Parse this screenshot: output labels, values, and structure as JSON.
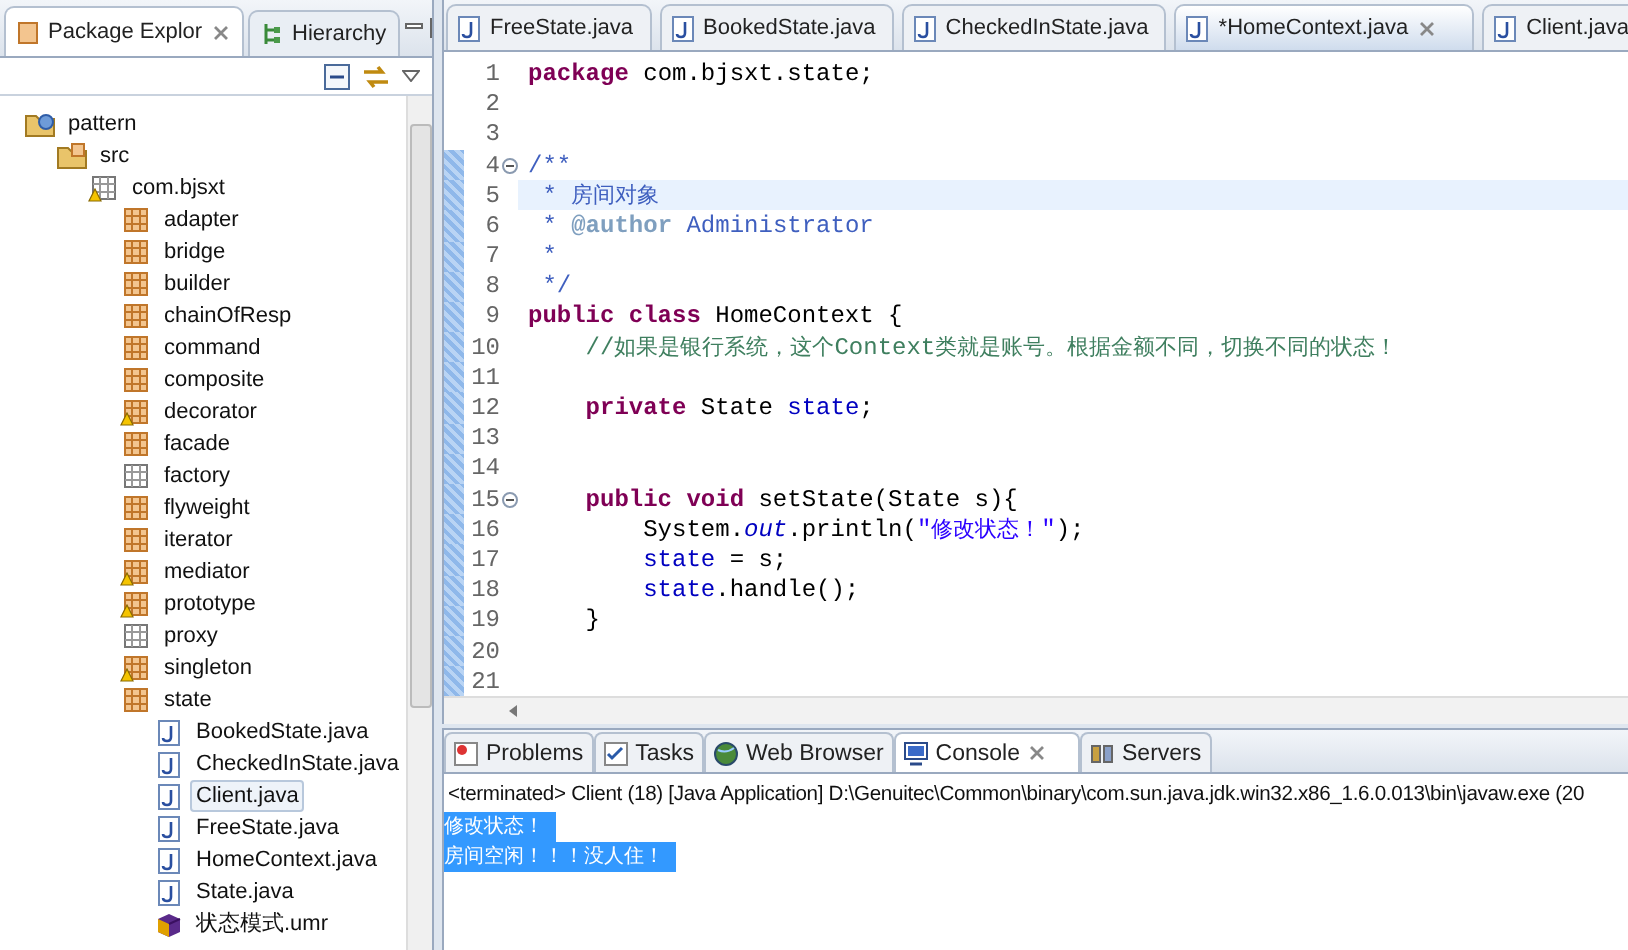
{
  "explorer": {
    "tabs": [
      {
        "label": "Package Explor",
        "selected": true
      },
      {
        "label": "Hierarchy",
        "selected": false
      }
    ],
    "tree": [
      {
        "label": "pattern",
        "kind": "project",
        "selected": false,
        "warning": false,
        "children": [
          {
            "label": "src",
            "kind": "source-folder",
            "selected": false,
            "warning": false,
            "children": [
              {
                "label": "com.bjsxt",
                "kind": "empty-package",
                "selected": false,
                "warning": true,
                "children": [
                  {
                    "label": "adapter",
                    "kind": "package",
                    "selected": false,
                    "warning": false
                  },
                  {
                    "label": "bridge",
                    "kind": "package",
                    "selected": false,
                    "warning": false
                  },
                  {
                    "label": "builder",
                    "kind": "package",
                    "selected": false,
                    "warning": false
                  },
                  {
                    "label": "chainOfResp",
                    "kind": "package",
                    "selected": false,
                    "warning": false
                  },
                  {
                    "label": "command",
                    "kind": "package",
                    "selected": false,
                    "warning": false
                  },
                  {
                    "label": "composite",
                    "kind": "package",
                    "selected": false,
                    "warning": false
                  },
                  {
                    "label": "decorator",
                    "kind": "package",
                    "selected": false,
                    "warning": true
                  },
                  {
                    "label": "facade",
                    "kind": "package",
                    "selected": false,
                    "warning": false
                  },
                  {
                    "label": "factory",
                    "kind": "empty-package",
                    "selected": false,
                    "warning": false
                  },
                  {
                    "label": "flyweight",
                    "kind": "package",
                    "selected": false,
                    "warning": false
                  },
                  {
                    "label": "iterator",
                    "kind": "package",
                    "selected": false,
                    "warning": false
                  },
                  {
                    "label": "mediator",
                    "kind": "package",
                    "selected": false,
                    "warning": true
                  },
                  {
                    "label": "prototype",
                    "kind": "package",
                    "selected": false,
                    "warning": true
                  },
                  {
                    "label": "proxy",
                    "kind": "empty-package",
                    "selected": false,
                    "warning": false
                  },
                  {
                    "label": "singleton",
                    "kind": "package",
                    "selected": false,
                    "warning": true
                  },
                  {
                    "label": "state",
                    "kind": "package",
                    "selected": false,
                    "warning": false,
                    "children": [
                      {
                        "label": "BookedState.java",
                        "kind": "java-file",
                        "selected": false,
                        "warning": false
                      },
                      {
                        "label": "CheckedInState.java",
                        "kind": "java-file",
                        "selected": false,
                        "warning": false
                      },
                      {
                        "label": "Client.java",
                        "kind": "java-file",
                        "selected": true,
                        "warning": false
                      },
                      {
                        "label": "FreeState.java",
                        "kind": "java-file",
                        "selected": false,
                        "warning": false
                      },
                      {
                        "label": "HomeContext.java",
                        "kind": "java-file",
                        "selected": false,
                        "warning": false
                      },
                      {
                        "label": "State.java",
                        "kind": "java-file",
                        "selected": false,
                        "warning": false
                      },
                      {
                        "label": "状态模式.umr",
                        "kind": "model-file",
                        "selected": false,
                        "warning": false
                      }
                    ]
                  }
                ]
              }
            ]
          }
        ]
      }
    ]
  },
  "editor": {
    "tabs": [
      {
        "label": "FreeState.java",
        "selected": false
      },
      {
        "label": "BookedState.java",
        "selected": false
      },
      {
        "label": "CheckedInState.java",
        "selected": false
      },
      {
        "label": "*HomeContext.java",
        "selected": true
      },
      {
        "label": "Client.java",
        "selected": false
      }
    ],
    "lines": [
      {
        "number": "1",
        "current": false,
        "changed": false,
        "fold": false,
        "tokens": [
          {
            "kind": "keyword",
            "text": "package"
          },
          {
            "kind": "plain",
            "text": " com.bjsxt.state;"
          }
        ]
      },
      {
        "number": "2",
        "current": false,
        "changed": false,
        "fold": false
      },
      {
        "number": "3",
        "current": false,
        "changed": false,
        "fold": false
      },
      {
        "number": "4",
        "current": false,
        "changed": true,
        "fold": true,
        "tokens": [
          {
            "kind": "javadoc",
            "text": "/**"
          }
        ]
      },
      {
        "number": "5",
        "current": true,
        "changed": true,
        "fold": false,
        "tokens": [
          {
            "kind": "javadoc",
            "text": " * 房间对象"
          }
        ]
      },
      {
        "number": "6",
        "current": false,
        "changed": true,
        "fold": false,
        "tokens": [
          {
            "kind": "javadoc",
            "text": " * "
          },
          {
            "kind": "javadoc-tag",
            "text": "@author"
          },
          {
            "kind": "javadoc",
            "text": " Administrator"
          }
        ]
      },
      {
        "number": "7",
        "current": false,
        "changed": true,
        "fold": false,
        "tokens": [
          {
            "kind": "javadoc",
            "text": " *"
          }
        ]
      },
      {
        "number": "8",
        "current": false,
        "changed": true,
        "fold": false,
        "tokens": [
          {
            "kind": "javadoc",
            "text": " */"
          }
        ]
      },
      {
        "number": "9",
        "current": false,
        "changed": true,
        "fold": false,
        "tokens": [
          {
            "kind": "keyword",
            "text": "public class"
          },
          {
            "kind": "plain",
            "text": " HomeContext {"
          }
        ]
      },
      {
        "number": "10",
        "current": false,
        "changed": true,
        "fold": false,
        "tokens": [
          {
            "kind": "comment",
            "text": "    //如果是银行系统，这个Context类就是账号。根据金额不同，切换不同的状态！"
          }
        ]
      },
      {
        "number": "11",
        "current": false,
        "changed": true,
        "fold": false
      },
      {
        "number": "12",
        "current": false,
        "changed": true,
        "fold": false,
        "tokens": [
          {
            "kind": "keyword",
            "text": "    private"
          },
          {
            "kind": "plain",
            "text": " State "
          },
          {
            "kind": "field",
            "text": "state"
          },
          {
            "kind": "plain",
            "text": ";"
          }
        ]
      },
      {
        "number": "13",
        "current": false,
        "changed": true,
        "fold": false
      },
      {
        "number": "14",
        "current": false,
        "changed": true,
        "fold": false
      },
      {
        "number": "15",
        "current": false,
        "changed": true,
        "fold": true,
        "tokens": [
          {
            "kind": "keyword",
            "text": "    public void"
          },
          {
            "kind": "plain",
            "text": " setState(State s){"
          }
        ]
      },
      {
        "number": "16",
        "current": false,
        "changed": true,
        "fold": false,
        "tokens": [
          {
            "kind": "plain",
            "text": "        System."
          },
          {
            "kind": "static-field",
            "text": "out"
          },
          {
            "kind": "plain",
            "text": ".println("
          },
          {
            "kind": "string",
            "text": "\"修改状态！\""
          },
          {
            "kind": "plain",
            "text": ");"
          }
        ]
      },
      {
        "number": "17",
        "current": false,
        "changed": true,
        "fold": false,
        "tokens": [
          {
            "kind": "field",
            "text": "        state"
          },
          {
            "kind": "plain",
            "text": " = s;"
          }
        ]
      },
      {
        "number": "18",
        "current": false,
        "changed": true,
        "fold": false,
        "tokens": [
          {
            "kind": "field",
            "text": "        state"
          },
          {
            "kind": "plain",
            "text": ".handle();"
          }
        ]
      },
      {
        "number": "19",
        "current": false,
        "changed": true,
        "fold": false,
        "tokens": [
          {
            "kind": "plain",
            "text": "    }"
          }
        ]
      },
      {
        "number": "20",
        "current": false,
        "changed": true,
        "fold": false
      },
      {
        "number": "21",
        "current": false,
        "changed": true,
        "fold": false
      }
    ]
  },
  "console": {
    "tabs": [
      {
        "label": "Problems",
        "selected": false
      },
      {
        "label": "Tasks",
        "selected": false
      },
      {
        "label": "Web Browser",
        "selected": false
      },
      {
        "label": "Console",
        "selected": true
      },
      {
        "label": "Servers",
        "selected": false
      }
    ],
    "header": "<terminated> Client (18) [Java Application] D:\\Genuitec\\Common\\binary\\com.sun.java.jdk.win32.x86_1.6.0.013\\bin\\javaw.exe (20",
    "output": [
      {
        "text": "修改状态！",
        "selected": true
      },
      {
        "text": "房间空闲！！！没人住！",
        "selected": true
      }
    ]
  }
}
